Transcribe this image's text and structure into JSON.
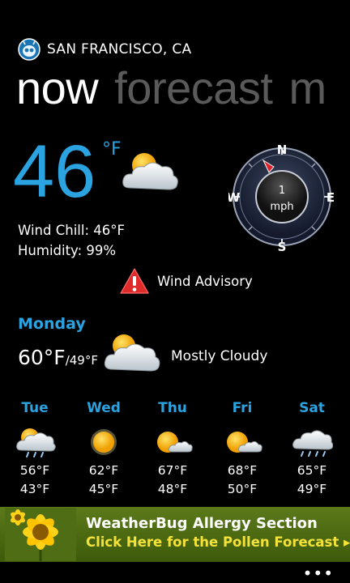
{
  "header": {
    "city": "SAN FRANCISCO, CA",
    "pivots": [
      "now",
      "forecast",
      "m"
    ]
  },
  "current": {
    "temperature": "46",
    "unit": "°F",
    "icon": "partly-cloudy-icon",
    "wind_chill": "Wind Chill:  46°F",
    "humidity": "Humidity: 99%",
    "wind_speed": "1",
    "wind_unit": "mph",
    "compass": {
      "n": "N",
      "e": "E",
      "s": "S",
      "w": "W"
    },
    "advisory": "Wind Advisory"
  },
  "today": {
    "day": "Monday",
    "high": "60°F",
    "low": "/49°F",
    "condition": "Mostly Cloudy",
    "icon": "mostly-cloudy-icon"
  },
  "forecast": [
    {
      "day": "Tue",
      "high": "56°F",
      "low": "43°F",
      "icon": "rain-sun-icon"
    },
    {
      "day": "Wed",
      "high": "62°F",
      "low": "45°F",
      "icon": "sun-icon"
    },
    {
      "day": "Thu",
      "high": "67°F",
      "low": "48°F",
      "icon": "partly-sunny-icon"
    },
    {
      "day": "Fri",
      "high": "68°F",
      "low": "50°F",
      "icon": "partly-sunny-icon"
    },
    {
      "day": "Sat",
      "high": "65°F",
      "low": "49°F",
      "icon": "rain-cloud-icon"
    }
  ],
  "ad": {
    "title": "WeatherBug Allergy Section",
    "subtitle": "Click Here for the Pollen Forecast ▸"
  },
  "appbar": {
    "more": "•••"
  },
  "colors": {
    "accent": "#2aa3e0",
    "ad_text": "#f4e23a"
  }
}
